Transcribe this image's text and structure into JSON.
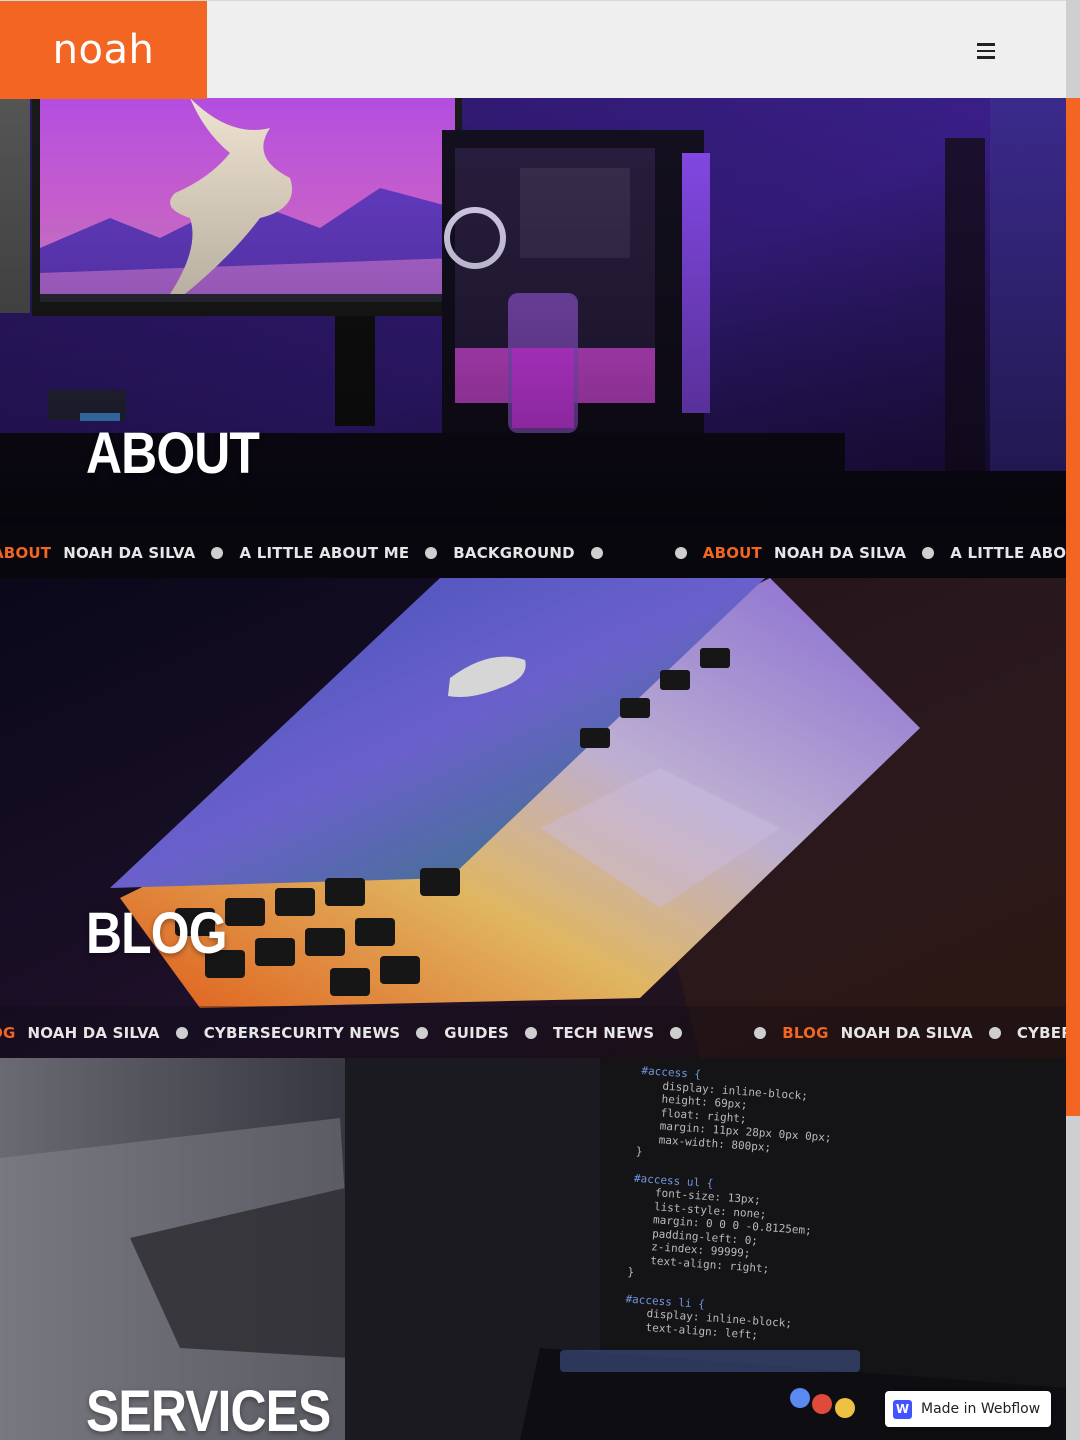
{
  "header": {
    "logo": "noah",
    "menu_icon": "hamburger-menu-icon"
  },
  "sections": [
    {
      "title": "ABOUT",
      "marquee": [
        "ABOUT",
        "NOAH DA SILVA",
        "A LITTLE ABOUT ME",
        "BACKGROUND"
      ],
      "image": "gaming-pc-desk-photo"
    },
    {
      "title": "BLOG",
      "marquee": [
        "BLOG",
        "NOAH DA SILVA",
        "CYBERSECURITY NEWS",
        "GUIDES",
        "TECH NEWS"
      ],
      "image": "laptop-photo"
    },
    {
      "title": "SERVICES",
      "image": "code-screen-photo"
    }
  ],
  "about_marquee": {
    "a0": "ABOUT",
    "a1": "NOAH DA SILVA",
    "a2": "A LITTLE ABOUT ME",
    "a3": "BACKGROUND"
  },
  "blog_marquee": {
    "b0": "BLOG",
    "b1": "NOAH DA SILVA",
    "b2": "CYBERSECURITY NEWS",
    "b3": "GUIDES",
    "b4": "TECH NEWS"
  },
  "code_lines": [
    "#access {",
    "display: inline-block;",
    "height: 69px;",
    "float: right;",
    "margin: 11px 28px 0px 0px;",
    "max-width: 800px;",
    "}",
    "#access ul {",
    "font-size: 13px;",
    "list-style: none;",
    "margin: 0 0 0 -0.8125em;",
    "padding-left: 0;",
    "z-index: 99999;",
    "text-align: right;",
    "}",
    "#access li {",
    "display: inline-block;",
    "text-align: left;"
  ],
  "badge": {
    "label": "Made in Webflow",
    "icon_letter": "W"
  },
  "colors": {
    "accent": "#f26522",
    "header_bg": "#efefef",
    "webflow_blue": "#4353ff"
  }
}
